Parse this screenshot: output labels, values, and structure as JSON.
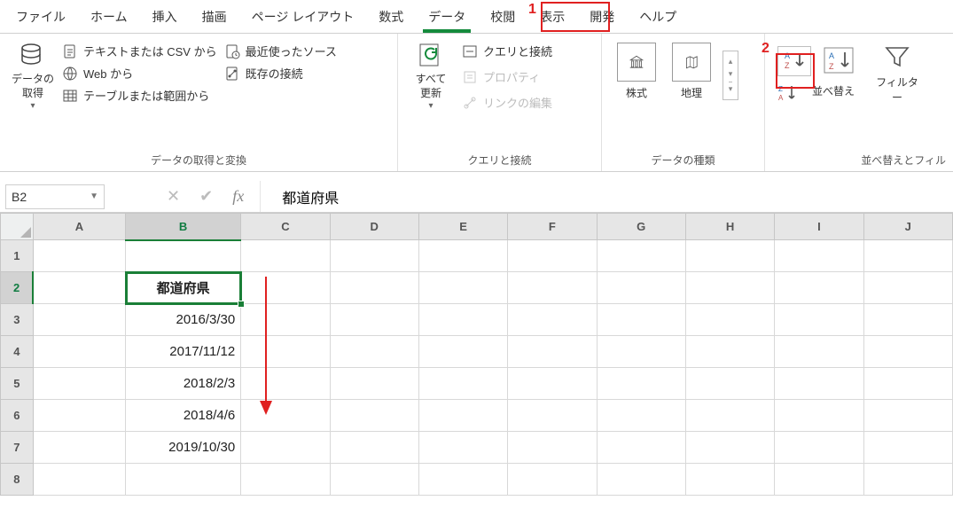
{
  "annotations": {
    "num1": "1",
    "num2": "2"
  },
  "tabs": {
    "file": "ファイル",
    "home": "ホーム",
    "insert": "挿入",
    "draw": "描画",
    "layout": "ページ レイアウト",
    "formula": "数式",
    "data": "データ",
    "review": "校閲",
    "view": "表示",
    "dev": "開発",
    "help": "ヘルプ"
  },
  "ribbon": {
    "g1": {
      "getdata": "データの\n取得",
      "csv": "テキストまたは CSV から",
      "web": "Web から",
      "table": "テーブルまたは範囲から",
      "recent": "最近使ったソース",
      "existing": "既存の接続",
      "label": "データの取得と変換"
    },
    "g2": {
      "refresh": "すべて\n更新",
      "qconn": "クエリと接続",
      "prop": "プロパティ",
      "linkedit": "リンクの編集",
      "label": "クエリと接続"
    },
    "g3": {
      "stocks": "株式",
      "geo": "地理",
      "label": "データの種類"
    },
    "g4": {
      "az": "A→Z",
      "za": "Z→A",
      "sortlbl": "並べ替え",
      "filter": "フィルター",
      "label": "並べ替えとフィル"
    }
  },
  "formulabar": {
    "cellref": "B2",
    "formula": "都道府県"
  },
  "columns": [
    "A",
    "B",
    "C",
    "D",
    "E",
    "F",
    "G",
    "H",
    "I",
    "J"
  ],
  "rows": [
    "1",
    "2",
    "3",
    "4",
    "5",
    "6",
    "7",
    "8"
  ],
  "cells": {
    "header": "都道府県",
    "dates": [
      "2016/3/30",
      "2017/11/12",
      "2018/2/3",
      "2018/4/6",
      "2019/10/30"
    ]
  },
  "colwidths": {
    "A": 108,
    "B": 132,
    "rest": 104
  },
  "active": {
    "col": 1,
    "row": 1
  }
}
